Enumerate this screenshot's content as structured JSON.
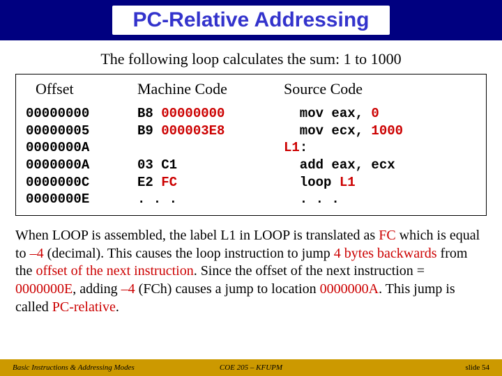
{
  "title": "PC-Relative Addressing",
  "subtitle": "The following loop calculates the sum: 1 to 1000",
  "headers": {
    "offset": "Offset",
    "machine": "Machine Code",
    "source": "Source Code"
  },
  "offsets": [
    "00000000",
    "00000005",
    "0000000A",
    "0000000A",
    "0000000C",
    "0000000E"
  ],
  "machine_lines": {
    "l0": "B8 ",
    "l0r": "00000000",
    "l1": "B9 ",
    "l1r": "000003E8",
    "l2": "",
    "l3": "03 C1",
    "l4": "E2 ",
    "l4r": "FC",
    "l5": ". . ."
  },
  "source_lines": {
    "l0a": "  mov eax, ",
    "l0b": "0",
    "l1a": "  mov ecx, ",
    "l1b": "1000",
    "l2a": "L1",
    "l2b": ":",
    "l3": "  add eax, ecx",
    "l4a": "  loop ",
    "l4b": "L1",
    "l5": "  . . ."
  },
  "explanation": {
    "p1": "When LOOP is assembled, the label L1 in LOOP is translated as ",
    "p1r1": "FC",
    "p2": " which is equal to ",
    "p2r": "–4",
    "p3": " (decimal). This causes the loop instruction to jump ",
    "p3r": "4 bytes backwards",
    "p4": " from the ",
    "p4r": "offset of the next instruction",
    "p5": ". Since the offset of the next instruction = ",
    "p5r": "0000000E",
    "p6": ", adding ",
    "p6r": "–4",
    "p7": " (FCh) causes a jump to location ",
    "p7r": "0000000A",
    "p8": ". This jump is called ",
    "p8r": "PC-relative",
    "p9": "."
  },
  "footer": {
    "left": "Basic Instructions & Addressing Modes",
    "center": "COE 205 – KFUPM",
    "right": "slide 54"
  }
}
